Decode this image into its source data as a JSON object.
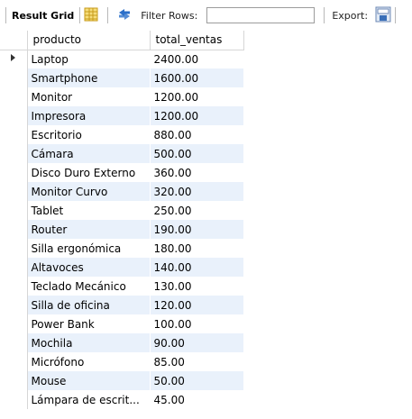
{
  "toolbar": {
    "result_grid_label": "Result Grid",
    "filter_label": "Filter Rows:",
    "filter_value": "",
    "export_label": "Export:"
  },
  "columns": [
    "producto",
    "total_ventas"
  ],
  "rows": [
    [
      "Laptop",
      "2400.00"
    ],
    [
      "Smartphone",
      "1600.00"
    ],
    [
      "Monitor",
      "1200.00"
    ],
    [
      "Impresora",
      "1200.00"
    ],
    [
      "Escritorio",
      "880.00"
    ],
    [
      "Cámara",
      "500.00"
    ],
    [
      "Disco Duro Externo",
      "360.00"
    ],
    [
      "Monitor Curvo",
      "320.00"
    ],
    [
      "Tablet",
      "250.00"
    ],
    [
      "Router",
      "190.00"
    ],
    [
      "Silla ergonómica",
      "180.00"
    ],
    [
      "Altavoces",
      "140.00"
    ],
    [
      "Teclado Mecánico",
      "130.00"
    ],
    [
      "Silla de oficina",
      "120.00"
    ],
    [
      "Power Bank",
      "100.00"
    ],
    [
      "Mochila",
      "90.00"
    ],
    [
      "Micrófono",
      "85.00"
    ],
    [
      "Mouse",
      "50.00"
    ],
    [
      "Lámpara de escrit...",
      "45.00"
    ]
  ],
  "icons": {
    "grid_icon": "grid-icon",
    "refresh_icon": "refresh-arrows-icon",
    "export_icon": "export-grid-icon"
  },
  "colors": {
    "alt_row": "#e9f1fb",
    "icon_blue": "#2b6fc9",
    "icon_yellow": "#f0c030"
  }
}
